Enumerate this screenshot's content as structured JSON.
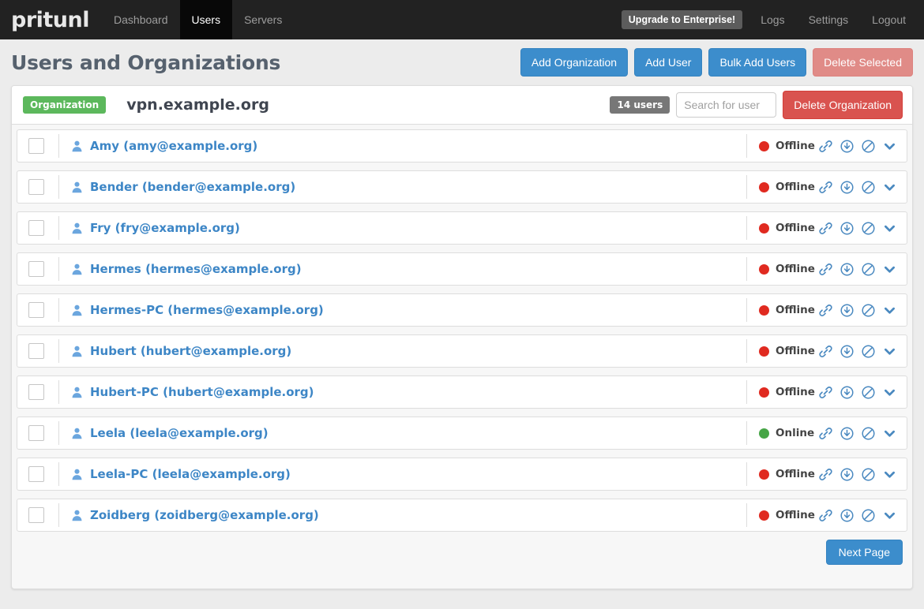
{
  "navbar": {
    "brand": "pritunl",
    "items": [
      {
        "label": "Dashboard",
        "active": false
      },
      {
        "label": "Users",
        "active": true
      },
      {
        "label": "Servers",
        "active": false
      }
    ],
    "upgrade_label": "Upgrade to Enterprise!",
    "right_items": [
      {
        "label": "Logs"
      },
      {
        "label": "Settings"
      },
      {
        "label": "Logout"
      }
    ]
  },
  "header": {
    "title": "Users and Organizations",
    "buttons": [
      {
        "label": "Add Organization",
        "style": "primary"
      },
      {
        "label": "Add User",
        "style": "primary"
      },
      {
        "label": "Bulk Add Users",
        "style": "primary"
      },
      {
        "label": "Delete Selected",
        "style": "danger-disabled"
      }
    ]
  },
  "organization": {
    "badge": "Organization",
    "name": "vpn.example.org",
    "user_count_badge": "14 users",
    "search_placeholder": "Search for user",
    "search_value": "",
    "delete_label": "Delete Organization"
  },
  "users": [
    {
      "name": "Amy (amy@example.org)",
      "status": "Offline",
      "online": false
    },
    {
      "name": "Bender (bender@example.org)",
      "status": "Offline",
      "online": false
    },
    {
      "name": "Fry (fry@example.org)",
      "status": "Offline",
      "online": false
    },
    {
      "name": "Hermes (hermes@example.org)",
      "status": "Offline",
      "online": false
    },
    {
      "name": "Hermes-PC (hermes@example.org)",
      "status": "Offline",
      "online": false
    },
    {
      "name": "Hubert (hubert@example.org)",
      "status": "Offline",
      "online": false
    },
    {
      "name": "Hubert-PC (hubert@example.org)",
      "status": "Offline",
      "online": false
    },
    {
      "name": "Leela (leela@example.org)",
      "status": "Online",
      "online": true
    },
    {
      "name": "Leela-PC (leela@example.org)",
      "status": "Offline",
      "online": false
    },
    {
      "name": "Zoidberg (zoidberg@example.org)",
      "status": "Offline",
      "online": false
    }
  ],
  "row_icons": [
    "link-icon",
    "download-icon",
    "ban-icon",
    "chevron-down-icon"
  ],
  "footer": {
    "next_page_label": "Next Page"
  },
  "colors": {
    "accent_blue": "#3c8dcc",
    "link_blue": "#3d86c6",
    "danger_red": "#d9534f",
    "danger_disabled": "#e08b87",
    "org_green": "#5cb85c",
    "status_online": "#46a546",
    "status_offline": "#e02a20",
    "navbar_bg": "#222222",
    "navbar_active_bg": "#080808",
    "page_bg": "#ececec"
  }
}
